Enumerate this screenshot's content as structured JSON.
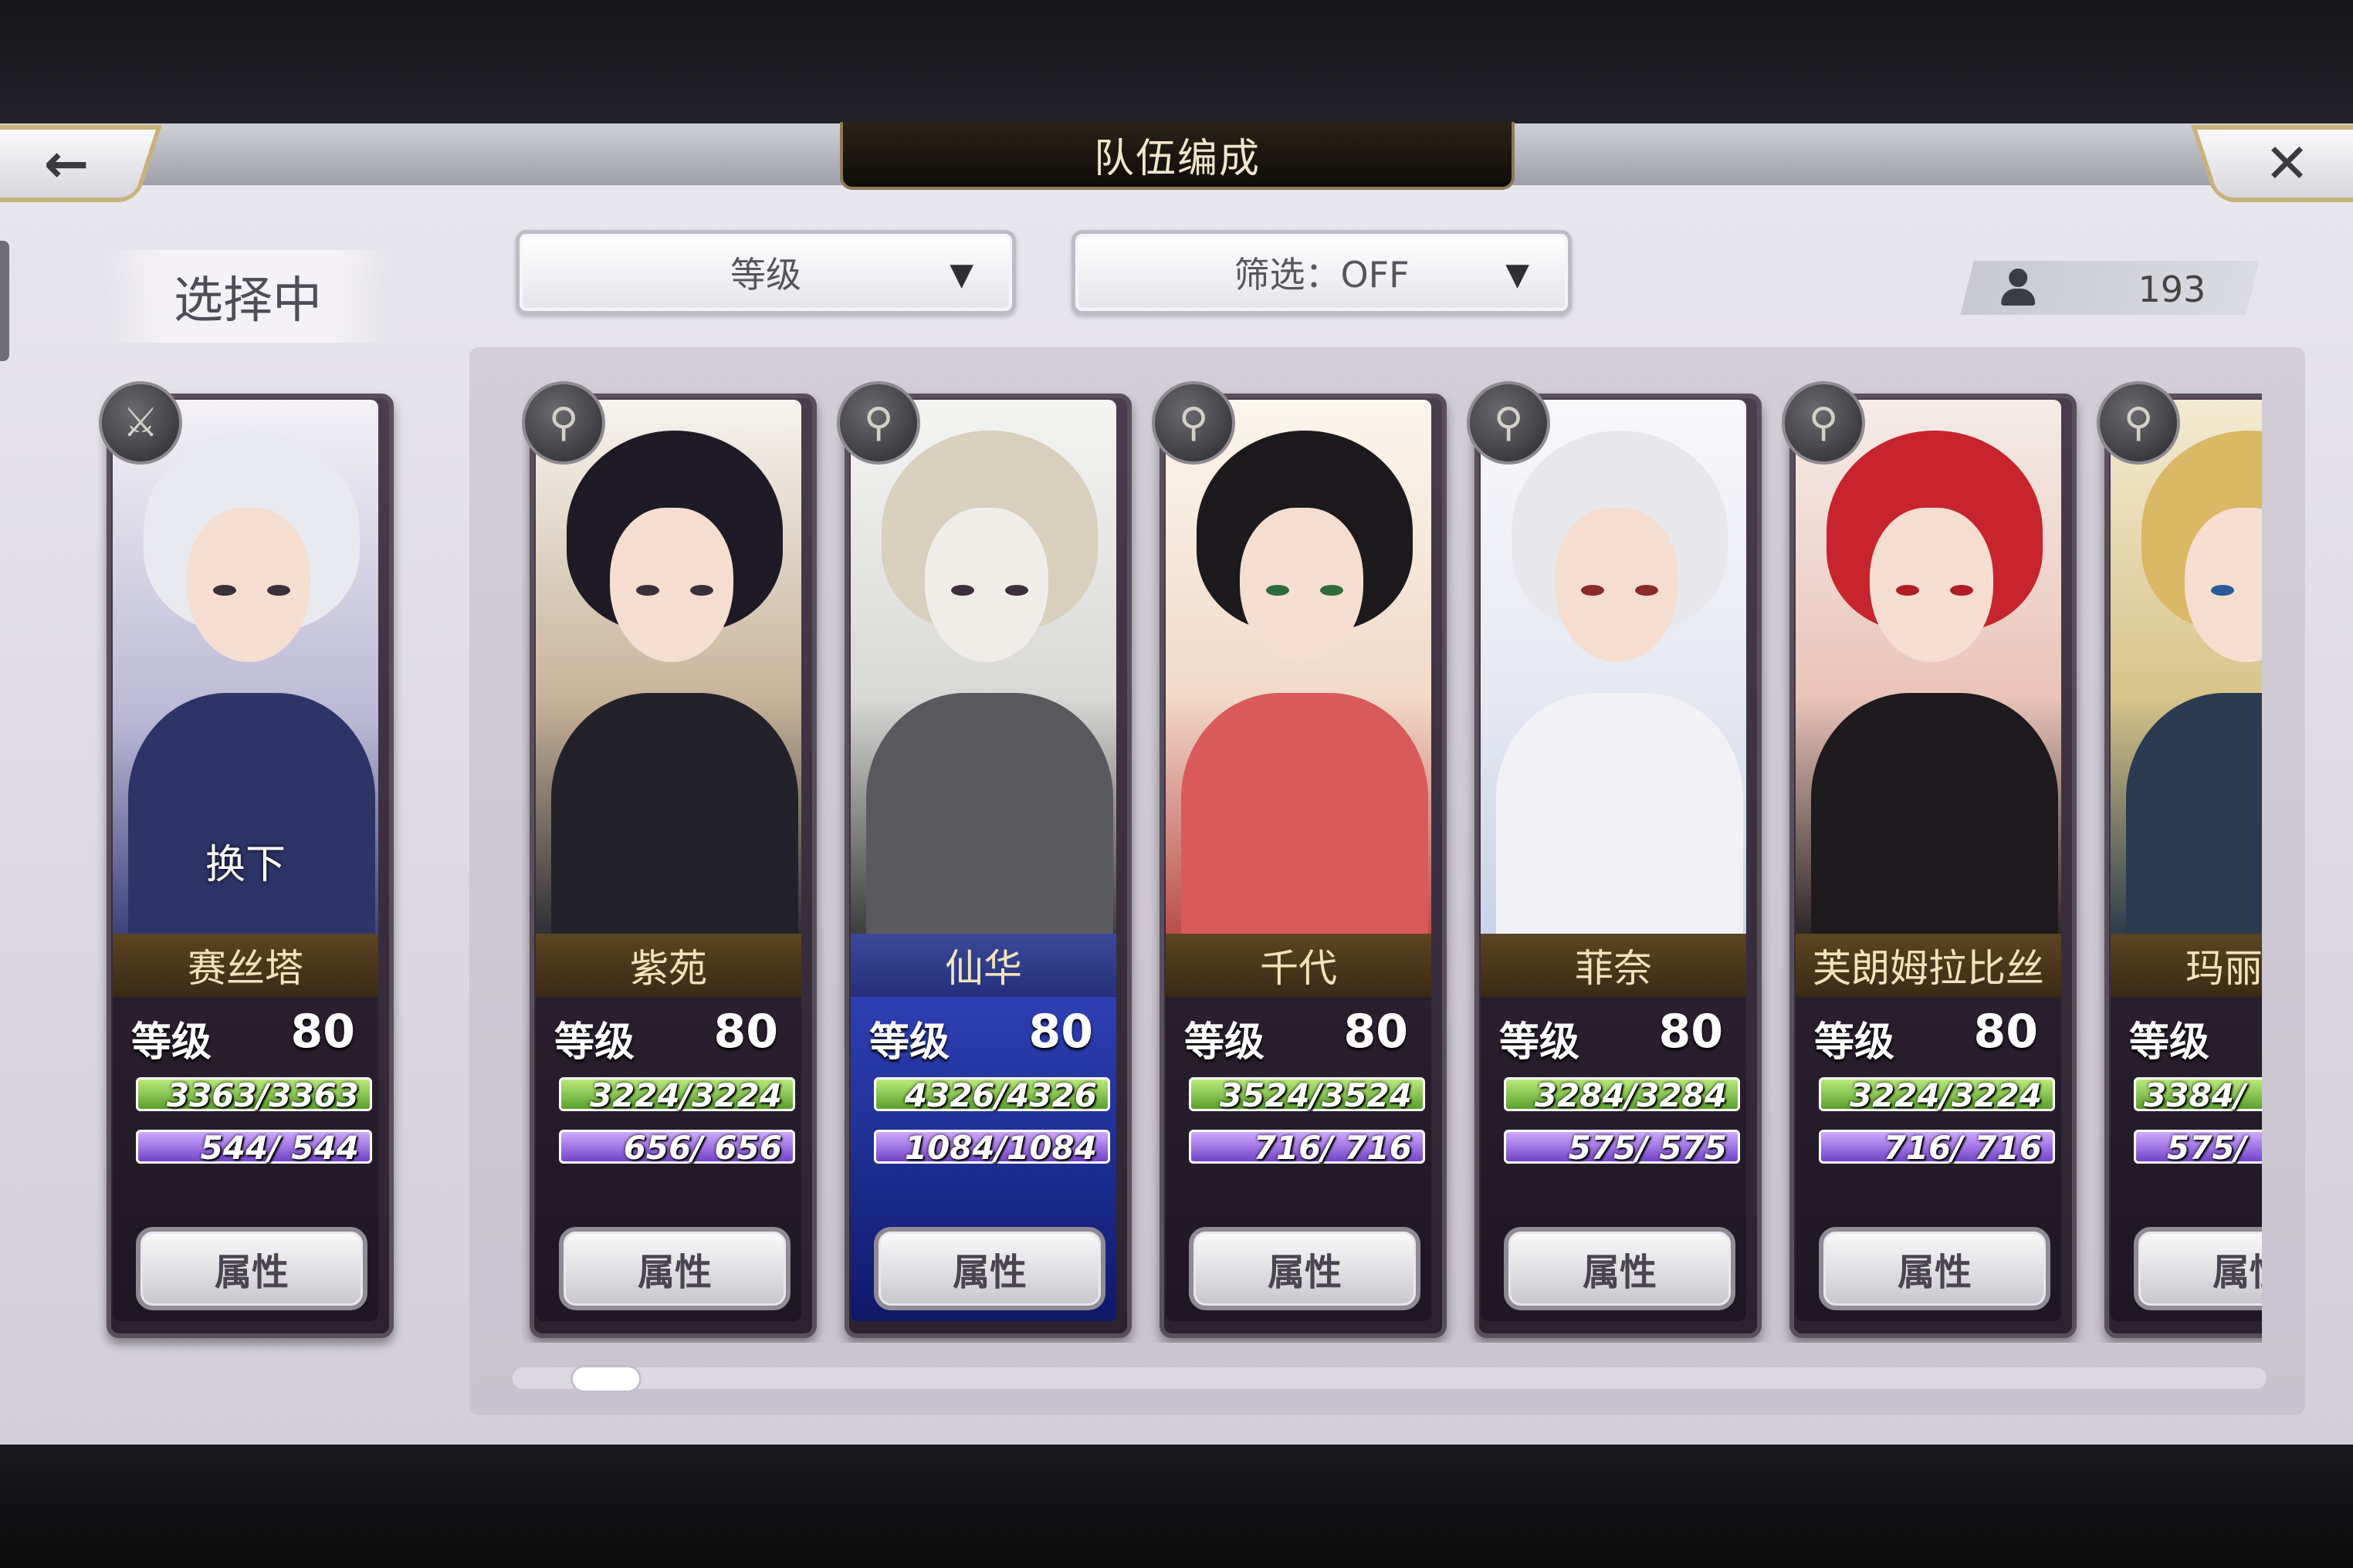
{
  "header": {
    "title": "队伍编成",
    "back_icon": "←",
    "close_icon": "✕"
  },
  "selecting": {
    "label": "选择中",
    "card": {
      "name": "赛丝塔",
      "level_label": "等级",
      "level": "80",
      "hp": "3363/3363",
      "mp": "544/ 544",
      "attr_label": "属性",
      "swap_label": "换下",
      "weapon_icon": "sword-icon"
    }
  },
  "toolbar": {
    "sort_label": "等级",
    "filter_label": "筛选：OFF",
    "dropdown_arrow": "▼",
    "unit_count": "193"
  },
  "roster": [
    {
      "name": "紫苑",
      "level_label": "等级",
      "level": "80",
      "hp": "3224/3224",
      "mp": "656/ 656",
      "attr_label": "属性",
      "weapon_icon": "staff-icon"
    },
    {
      "name": "仙华",
      "level_label": "等级",
      "level": "80",
      "hp": "4326/4326",
      "mp": "1084/1084",
      "attr_label": "属性",
      "weapon_icon": "staff-icon"
    },
    {
      "name": "千代",
      "level_label": "等级",
      "level": "80",
      "hp": "3524/3524",
      "mp": "716/ 716",
      "attr_label": "属性",
      "weapon_icon": "staff-icon"
    },
    {
      "name": "菲奈",
      "level_label": "等级",
      "level": "80",
      "hp": "3284/3284",
      "mp": "575/ 575",
      "attr_label": "属性",
      "weapon_icon": "staff-icon"
    },
    {
      "name": "芙朗姆拉比丝",
      "level_label": "等级",
      "level": "80",
      "hp": "3224/3224",
      "mp": "716/ 716",
      "attr_label": "属性",
      "weapon_icon": "staff-icon"
    },
    {
      "name": "玛丽埃",
      "level_label": "等级",
      "level": "",
      "hp": "3384/",
      "mp": "575/",
      "attr_label": "属性",
      "weapon_icon": "staff-icon"
    }
  ],
  "colors": {
    "name_band": "#4a3519",
    "hp_bar": "#7cc446",
    "mp_bar": "#9a66e6",
    "highlight_card": "#1e2e9a"
  }
}
